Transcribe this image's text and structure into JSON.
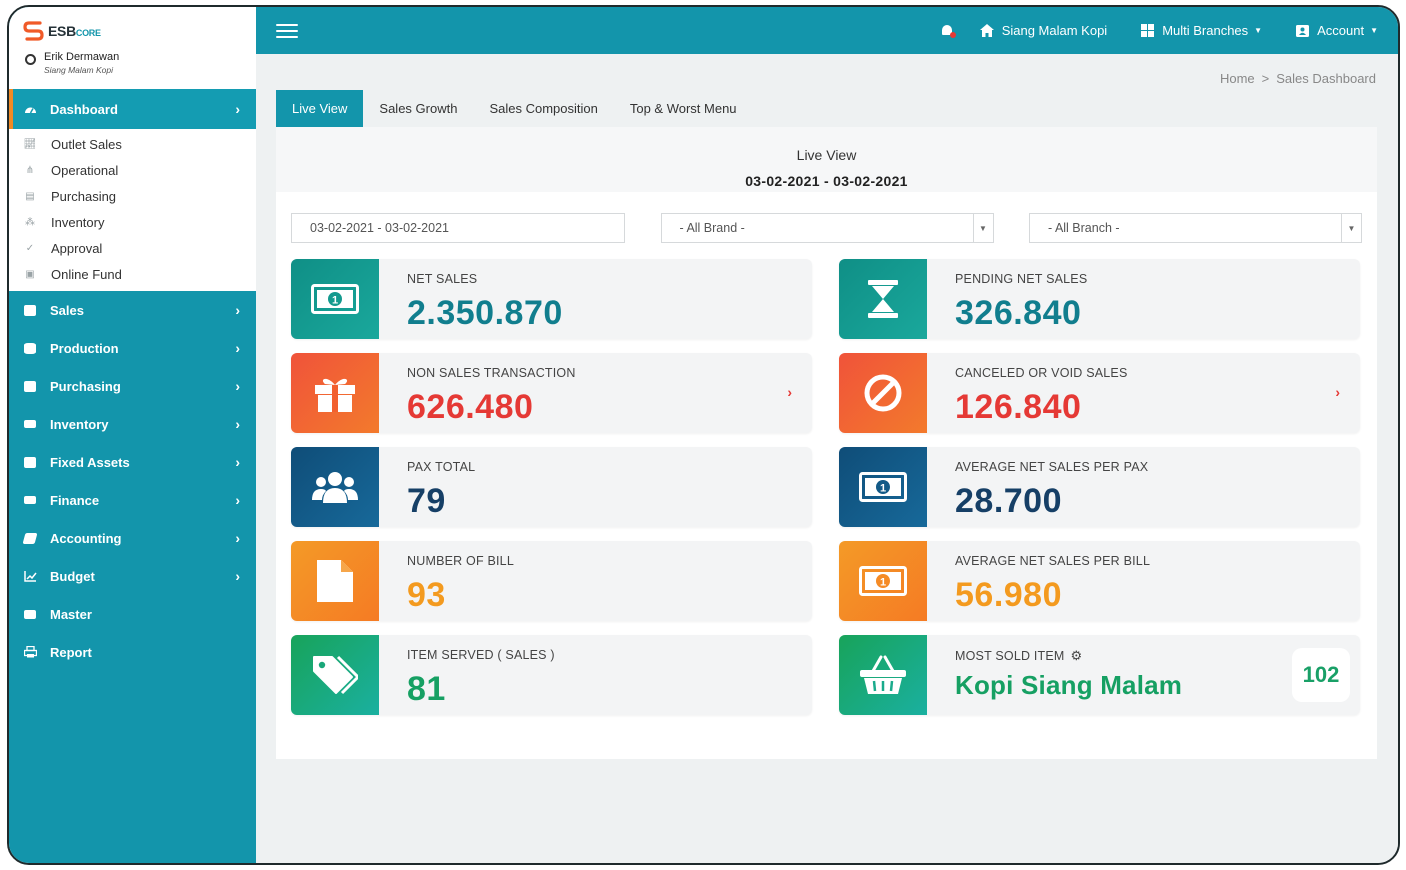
{
  "app": {
    "brand_main": "ESB",
    "brand_sub": "CORE",
    "user_name": "Erik Dermawan",
    "user_outlet": "Siang Malam Kopi"
  },
  "topbar": {
    "outlet": "Siang Malam Kopi",
    "branches": "Multi Branches",
    "account": "Account"
  },
  "sidebar": {
    "dashboard": "Dashboard",
    "sub_items": [
      "Outlet Sales",
      "Operational",
      "Purchasing",
      "Inventory",
      "Approval",
      "Online Fund"
    ],
    "items": [
      {
        "label": "Sales",
        "chevron": true
      },
      {
        "label": "Production",
        "chevron": true
      },
      {
        "label": "Purchasing",
        "chevron": true
      },
      {
        "label": "Inventory",
        "chevron": true
      },
      {
        "label": "Fixed Assets",
        "chevron": true
      },
      {
        "label": "Finance",
        "chevron": true
      },
      {
        "label": "Accounting",
        "chevron": true
      },
      {
        "label": "Budget",
        "chevron": true
      },
      {
        "label": "Master",
        "chevron": false
      },
      {
        "label": "Report",
        "chevron": false
      }
    ]
  },
  "breadcrumb": {
    "home": "Home",
    "sep": ">",
    "current": "Sales Dashboard"
  },
  "tabs": [
    "Live View",
    "Sales Growth",
    "Sales Composition",
    "Top & Worst Menu"
  ],
  "panel": {
    "title": "Live View",
    "range": "03-02-2021 - 03-02-2021"
  },
  "filters": {
    "date": "03-02-2021 - 03-02-2021",
    "brand": "- All Brand -",
    "branch": "- All Branch -"
  },
  "cards": {
    "net_sales": {
      "label": "NET SALES",
      "value": "2.350.870"
    },
    "pending_net_sales": {
      "label": "PENDING NET SALES",
      "value": "326.840"
    },
    "non_sales": {
      "label": "NON SALES TRANSACTION",
      "value": "626.480"
    },
    "canceled": {
      "label": "CANCELED OR VOID SALES",
      "value": "126.840"
    },
    "pax_total": {
      "label": "PAX TOTAL",
      "value": "79"
    },
    "avg_pax": {
      "label": "AVERAGE NET SALES PER PAX",
      "value": "28.700"
    },
    "num_bill": {
      "label": "NUMBER OF BILL",
      "value": "93"
    },
    "avg_bill": {
      "label": "AVERAGE NET SALES PER BILL",
      "value": "56.980"
    },
    "item_served": {
      "label": "ITEM SERVED ( SALES )",
      "value": "81"
    },
    "most_sold": {
      "label": "MOST SOLD ITEM",
      "value": "Kopi Siang Malam",
      "count": "102"
    }
  },
  "colors": {
    "primary": "#1395ab",
    "teal_value": "#117e8e",
    "red_value": "#e53935",
    "navy_value": "#163f66",
    "orange_value": "#f39a1f",
    "green_value": "#16a063"
  }
}
